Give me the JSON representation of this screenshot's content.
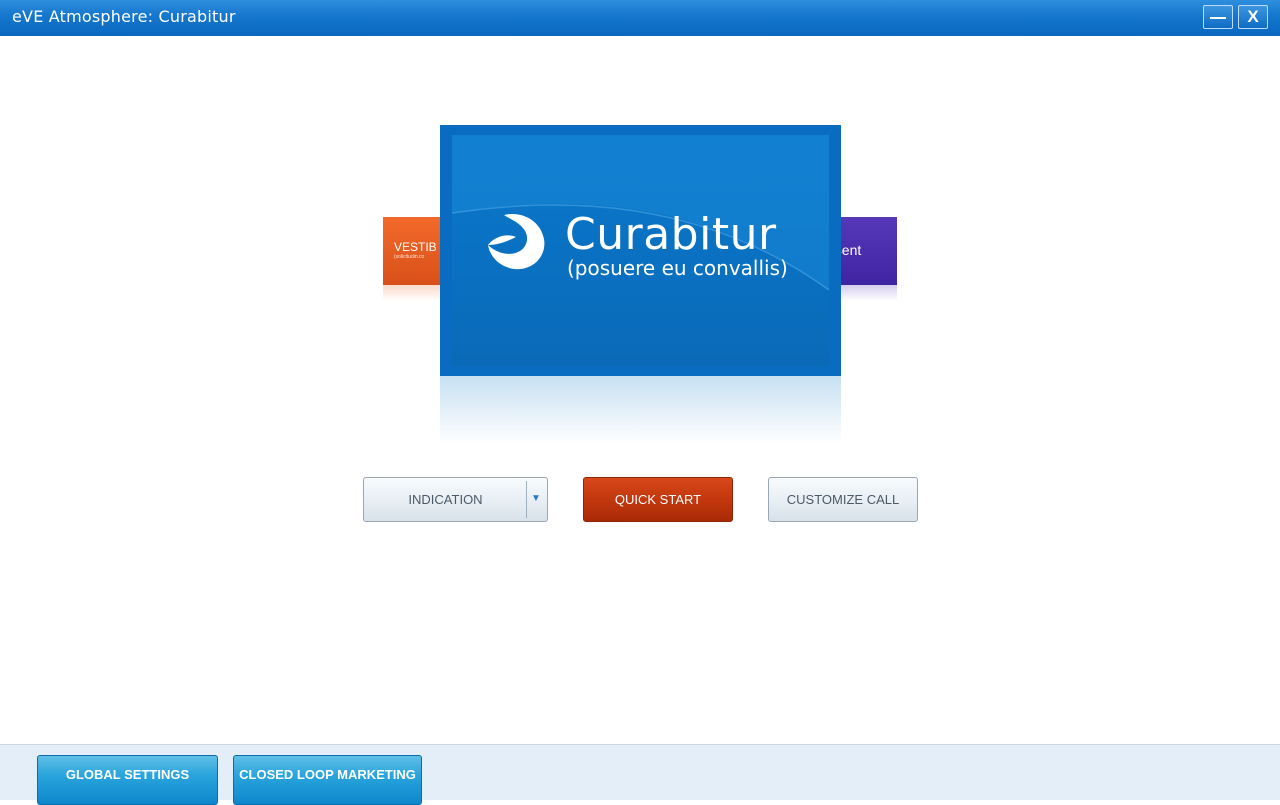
{
  "window": {
    "title": "eVE Atmosphere: Curabitur",
    "close_label": "X"
  },
  "carousel": {
    "left_card": {
      "label": "VESTIB",
      "sub": "(solicitudin.co"
    },
    "right_card": {
      "label": "esent"
    },
    "main_card": {
      "brand": "Curabitur",
      "tagline": "(posuere eu convallis)"
    }
  },
  "actions": {
    "indication_label": "INDICATION",
    "indication_arrow": "▼",
    "quick_start_label": "QUICK START",
    "customize_label": "CUSTOMIZE CALL"
  },
  "bottom": {
    "global_settings_label": "GLOBAL SETTINGS",
    "closed_loop_label": "CLOSED LOOP MARKETING"
  },
  "colors": {
    "titlebar": "#0a68bf",
    "quick_start": "#c0360d",
    "brand_blue": "#0a6cc0",
    "left_card": "#e05a20",
    "right_card": "#4a2cab"
  }
}
